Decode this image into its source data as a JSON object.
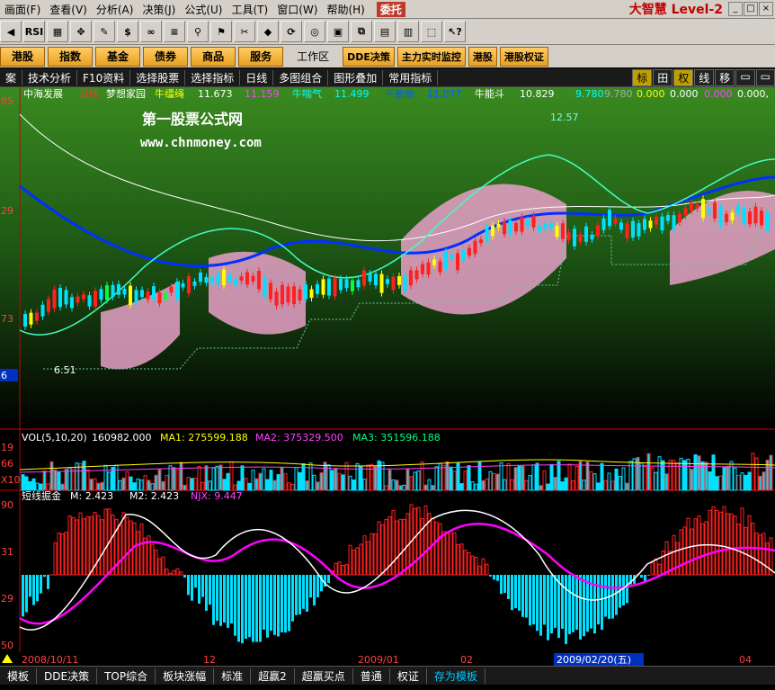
{
  "menubar": {
    "items": [
      "画面(F)",
      "查看(V)",
      "分析(A)",
      "决策(J)",
      "公式(U)",
      "工具(T)",
      "窗口(W)",
      "帮助(H)"
    ],
    "wt_label": "委托",
    "brand": "大智慧 Level-2",
    "window_controls": [
      "_",
      "□",
      "×"
    ]
  },
  "toolbar": {
    "buttons": [
      "◀",
      "RSI",
      "▦",
      "✥",
      "✎",
      "$",
      "∞",
      "≡",
      "⚲",
      "⚑",
      "✂",
      "◆",
      "⟳",
      "◎",
      "▣",
      "⧉",
      "▤",
      "▥",
      "⬚",
      "↖?"
    ]
  },
  "navbar": {
    "buttons": [
      "港股",
      "指数",
      "基金",
      "债券",
      "商品",
      "服务"
    ],
    "workzone": "工作区",
    "right_buttons": [
      "DDE决策",
      "主力实时监控",
      "港股",
      "港股权证"
    ]
  },
  "tabs": {
    "left": [
      "案",
      "技术分析",
      "F10资料",
      "选择股票",
      "选择指标",
      "日线",
      "多图组合",
      "图形叠加",
      "常用指标"
    ],
    "right": [
      "标",
      "田",
      "权",
      "线",
      "移",
      "▭",
      "▭"
    ]
  },
  "main": {
    "stock_name": "中海发展",
    "period": "日线",
    "formula": "梦想家园",
    "ind1_label": "牛缰绳",
    "ind1_value": "11.673",
    "ind2_value": "11.159",
    "ind3_label": "牛喘气",
    "ind3_value": "11.499",
    "ind4_label": "干脆赛",
    "ind4_value": "11.077",
    "ind5_label": "牛能斗",
    "ind5_value": "10.829",
    "tail_values": [
      "9.780",
      "9.780",
      "0.000",
      "0.000",
      "0.000",
      "0.000,"
    ],
    "watermark_title": "第一股票公式网",
    "watermark_url": "www.chnmoney.com",
    "high_label": "12.57",
    "low_label": "6.51",
    "price_ticks": [
      "85",
      "29",
      "73",
      "6"
    ]
  },
  "volume": {
    "label": "VOL(5,10,20)",
    "value": "160982.000",
    "ma1": "MA1: 275599.188",
    "ma2": "MA2: 375329.500",
    "ma3": "MA3: 351596.188",
    "ticks": [
      "19",
      "66",
      "X10"
    ]
  },
  "osc": {
    "label": "短线掘金",
    "m": "M: 2.423",
    "m2": "M2: 2.423",
    "njx": "NJX: 9.447",
    "ticks": [
      "90",
      "31",
      "29",
      "50"
    ]
  },
  "dates": [
    "2008/10/11",
    "12",
    "2009/01",
    "02",
    "2009/02/20(五)",
    "04"
  ],
  "statusbar": [
    "模板",
    "DDE决策",
    "TOP综合",
    "板块涨幅",
    "标准",
    "超赢2",
    "超赢买点",
    "普通",
    "权证",
    "存为模板"
  ],
  "colors": {
    "up": "#ff2020",
    "down": "#00e0ff",
    "ma_blue": "#0030ff",
    "ma_white": "#ffffff",
    "band": "#e8a0c8",
    "osc_line": "#ff00ff"
  }
}
